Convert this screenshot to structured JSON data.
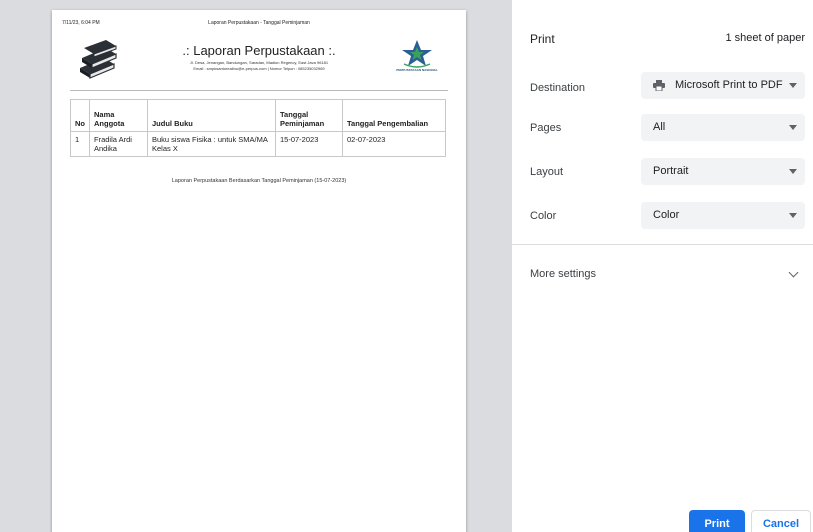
{
  "preview": {
    "header_left": "7/11/23, 6:04 PM",
    "header_center": "Laporan Perpustakaan - Tanggal Peminjaman",
    "report_title": ".: Laporan Perpustakaan :.",
    "address_line1": "Jl. Desa, Jenangan, Bandungan, Saradan, Madiun Regency, East Java 96181",
    "address_line2": "Email : smpksantorealino@e-perpus.com | Nomor Telpon : 085235032969",
    "logo_caption": "PERPUSTAKAAN NASIONAL",
    "table": {
      "headers": [
        "No",
        "Nama Anggota",
        "Judul Buku",
        "Tanggal Peminjaman",
        "Tanggal Pengembalian"
      ],
      "rows": [
        [
          "1",
          "Fradila Ardi Andika",
          "Buku siswa Fisika : untuk SMA/MA Kelas X",
          "15-07-2023",
          "02-07-2023"
        ]
      ]
    },
    "caption": "Laporan Perpustakaan Berdasarkan Tanggal Peminjaman (15-07-2023)"
  },
  "panel": {
    "title": "Print",
    "sheets": "1 sheet of paper",
    "destination_label": "Destination",
    "destination_value": "Microsoft Print to PDF",
    "pages_label": "Pages",
    "pages_value": "All",
    "layout_label": "Layout",
    "layout_value": "Portrait",
    "color_label": "Color",
    "color_value": "Color",
    "more_settings": "More settings",
    "print_button": "Print",
    "cancel_button": "Cancel"
  },
  "colors": {
    "accent": "#1a73e8",
    "preview_bg": "#dadce0",
    "select_bg": "#f1f3f4"
  },
  "icons": [
    "book-stack-icon",
    "national-library-logo",
    "printer-icon",
    "chevron-down-icon",
    "dropdown-caret-icon"
  ]
}
